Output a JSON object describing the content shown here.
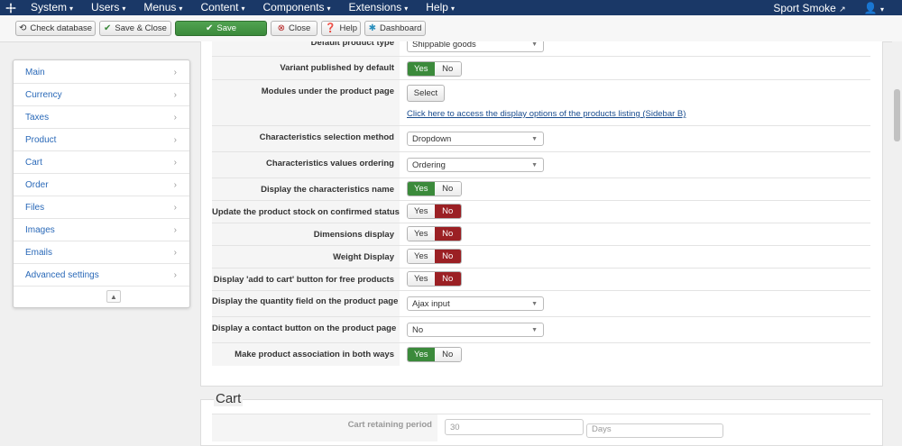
{
  "navbar": {
    "menus": [
      {
        "label": "System"
      },
      {
        "label": "Users"
      },
      {
        "label": "Menus"
      },
      {
        "label": "Content"
      },
      {
        "label": "Components"
      },
      {
        "label": "Extensions"
      },
      {
        "label": "Help"
      }
    ],
    "site_name": "Sport Smoke"
  },
  "toolbar": {
    "check_database": "Check database",
    "save_close": "Save & Close",
    "save": "Save",
    "close": "Close",
    "help": "Help",
    "dashboard": "Dashboard"
  },
  "sidebar": {
    "items": [
      {
        "label": "Main"
      },
      {
        "label": "Currency"
      },
      {
        "label": "Taxes"
      },
      {
        "label": "Product"
      },
      {
        "label": "Cart"
      },
      {
        "label": "Order"
      },
      {
        "label": "Files"
      },
      {
        "label": "Images"
      },
      {
        "label": "Emails"
      },
      {
        "label": "Advanced settings"
      }
    ]
  },
  "options": {
    "default_product_type": {
      "label": "Default product type",
      "value": "Shippable goods"
    },
    "variant_published": {
      "label": "Variant published by default",
      "yes": "Yes",
      "no": "No",
      "selected": "Yes"
    },
    "modules_under_product": {
      "label": "Modules under the product page",
      "button": "Select",
      "link": "Click here to access the display options of the products listing (Sidebar B)"
    },
    "characteristics_method": {
      "label": "Characteristics selection method",
      "value": "Dropdown"
    },
    "characteristics_ordering": {
      "label": "Characteristics values ordering",
      "value": "Ordering"
    },
    "display_char_name": {
      "label": "Display the characteristics name",
      "yes": "Yes",
      "no": "No",
      "selected": "Yes"
    },
    "update_stock": {
      "label": "Update the product stock on confirmed status",
      "yes": "Yes",
      "no": "No",
      "selected": "No"
    },
    "dimensions_display": {
      "label": "Dimensions display",
      "yes": "Yes",
      "no": "No",
      "selected": "No"
    },
    "weight_display": {
      "label": "Weight Display",
      "yes": "Yes",
      "no": "No",
      "selected": "No"
    },
    "add_to_cart_free": {
      "label": "Display 'add to cart' button for free products",
      "yes": "Yes",
      "no": "No",
      "selected": "No"
    },
    "quantity_field": {
      "label": "Display the quantity field on the product page",
      "value": "Ajax input"
    },
    "contact_button": {
      "label": "Display a contact button on the product page",
      "value": "No"
    },
    "association_both": {
      "label": "Make product association in both ways",
      "yes": "Yes",
      "no": "No",
      "selected": "Yes"
    }
  },
  "cart": {
    "legend": "Cart",
    "retaining_label": "Cart retaining period",
    "retaining_value": "30",
    "retaining_unit": "Days"
  }
}
